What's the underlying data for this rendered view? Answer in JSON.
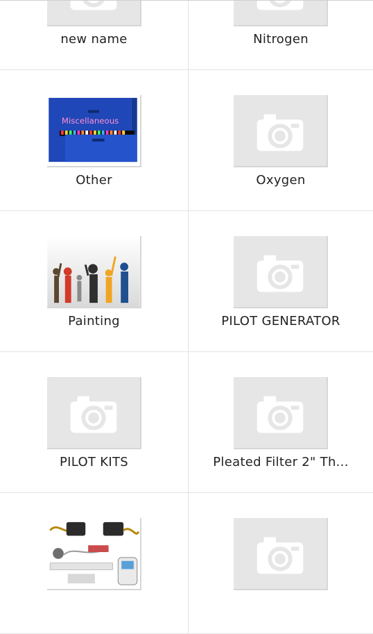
{
  "categories": [
    {
      "name": "new name",
      "image": "placeholder-camera-icon"
    },
    {
      "name": "Nitrogen",
      "image": "placeholder-camera-icon"
    },
    {
      "name": "Other",
      "image": "miscellaneous-cabinet-photo",
      "image_text": "Miscellaneous"
    },
    {
      "name": "Oxygen",
      "image": "placeholder-camera-icon"
    },
    {
      "name": "Painting",
      "image": "painters-silhouette-photo"
    },
    {
      "name": "PILOT GENERATOR",
      "image": "placeholder-camera-icon"
    },
    {
      "name": "PILOT KITS",
      "image": "placeholder-camera-icon"
    },
    {
      "name": "Pleated Filter 2\" Th...",
      "image": "placeholder-camera-icon"
    },
    {
      "name": "",
      "image": "control-kit-photo"
    },
    {
      "name": "",
      "image": "placeholder-camera-icon"
    }
  ]
}
